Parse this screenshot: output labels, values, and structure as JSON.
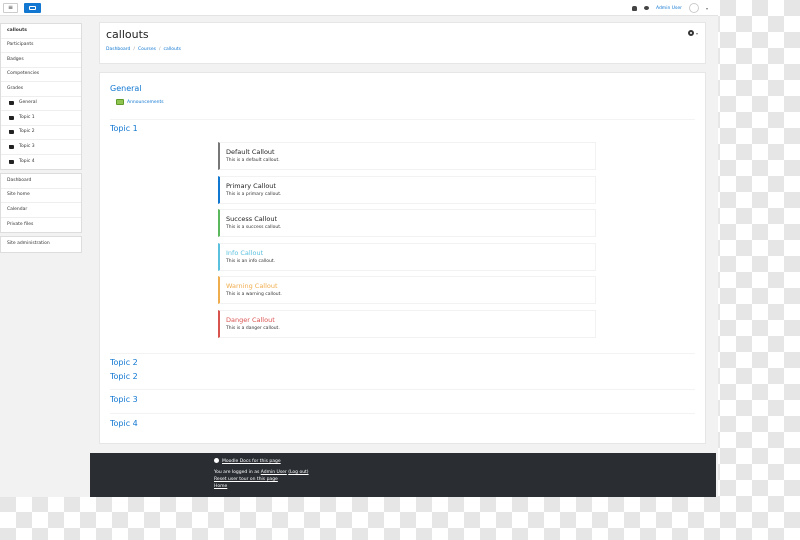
{
  "navbar": {
    "toggle_glyph": "≡",
    "user_name": "Admin User",
    "caret": "▾",
    "icons": [
      "menu-icon",
      "brand-logo-icon",
      "bell-icon",
      "chat-icon",
      "avatar",
      "caret-down-icon"
    ]
  },
  "sidebar": {
    "group1": [
      {
        "label": "callouts",
        "active": true
      },
      {
        "label": "Participants"
      },
      {
        "label": "Badges"
      },
      {
        "label": "Competencies"
      },
      {
        "label": "Grades"
      },
      {
        "label": "General",
        "icon": "folder-icon"
      },
      {
        "label": "Topic 1",
        "icon": "folder-icon"
      },
      {
        "label": "Topic 2",
        "icon": "folder-icon"
      },
      {
        "label": "Topic 3",
        "icon": "folder-icon"
      },
      {
        "label": "Topic 4",
        "icon": "folder-icon"
      }
    ],
    "group2": [
      {
        "label": "Dashboard"
      },
      {
        "label": "Site home"
      },
      {
        "label": "Calendar"
      },
      {
        "label": "Private files"
      }
    ],
    "group3": [
      {
        "label": "Site administration"
      }
    ]
  },
  "header": {
    "title": "callouts",
    "breadcrumb": [
      "Dashboard",
      "Courses",
      "callouts"
    ],
    "separator": "/",
    "gear_caret": "▾"
  },
  "content": {
    "general_title": "General",
    "announcements": "Announcements",
    "topic1_title": "Topic 1",
    "callouts": [
      {
        "title": "Default Callout",
        "text": "This is a default callout.",
        "color": "#777777",
        "title_color": "#222222"
      },
      {
        "title": "Primary Callout",
        "text": "This is a primary callout.",
        "color": "#1177d1",
        "title_color": "#222222"
      },
      {
        "title": "Success Callout",
        "text": "This is a success callout.",
        "color": "#5cb85c",
        "title_color": "#222222"
      },
      {
        "title": "Info Callout",
        "text": "This is an info callout.",
        "color": "#5bc0de",
        "title_color": "#5bc0de"
      },
      {
        "title": "Warning Callout",
        "text": "This is a warning callout.",
        "color": "#f0ad4e",
        "title_color": "#f0ad4e"
      },
      {
        "title": "Danger Callout",
        "text": "This is a danger callout.",
        "color": "#d9534f",
        "title_color": "#d9534f"
      }
    ],
    "topics_after": [
      "Topic 2",
      "Topic 2",
      "Topic 3",
      "Topic 4"
    ]
  },
  "footer": {
    "docs_link": "Moodle Docs for this page",
    "logged_in_prefix": "You are logged in as",
    "logged_in_user": "Admin User",
    "logout": "(Log out)",
    "reset_tour": "Reset user tour on this page",
    "home": "Home"
  },
  "colors": {
    "link": "#1177d1",
    "footer_bg": "#2a2e33"
  }
}
